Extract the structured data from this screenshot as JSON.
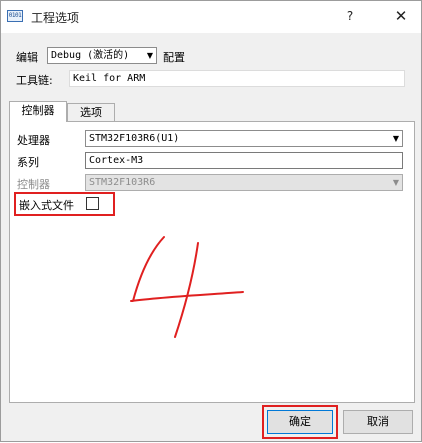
{
  "window": {
    "title": "工程选项",
    "icon_label": "0101",
    "help_label": "?",
    "close_label": "✕"
  },
  "header": {
    "edit_label": "编辑",
    "config_value": "Debug (激活的)",
    "config_label": "配置",
    "toolchain_label": "工具链:",
    "toolchain_value": "Keil for ARM"
  },
  "tabs": [
    {
      "label": "控制器",
      "active": true
    },
    {
      "label": "选项",
      "active": false
    }
  ],
  "controller": {
    "processor_label": "处理器",
    "processor_value": "STM32F103R6(U1)",
    "series_label": "系列",
    "series_value": "Cortex-M3",
    "controller_label": "控制器",
    "controller_value": "STM32F103R6",
    "embedded_label": "嵌入式文件",
    "embedded_checked": false
  },
  "annotation": {
    "handwritten_text": "4",
    "color": "#e02020"
  },
  "footer": {
    "ok_label": "确定",
    "cancel_label": "取消"
  },
  "colors": {
    "accent": "#0078d7",
    "highlight_red": "#e02020"
  }
}
